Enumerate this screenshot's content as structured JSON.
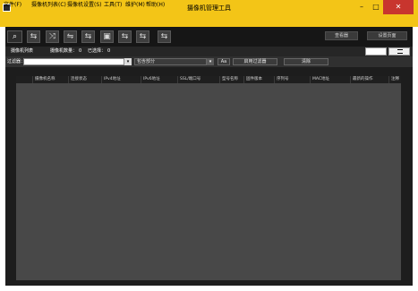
{
  "window": {
    "title": "摄像机管理工具",
    "minimize_glyph": "–",
    "maximize_glyph": "□",
    "close_glyph": "✕"
  },
  "menu": [
    {
      "label": "文件(F)"
    },
    {
      "label": "摄像机列表(C)"
    },
    {
      "label": "摄像机设置(S)"
    },
    {
      "label": "工具(T)"
    },
    {
      "label": "维护(M)"
    },
    {
      "label": "帮助(H)"
    }
  ],
  "toolbar": {
    "search_glyph": "⌕",
    "tool_glyphs": [
      "⇆",
      "⤨",
      "⇋",
      "⇆",
      "▣",
      "⇆",
      "⇆",
      "⇆"
    ],
    "right_buttons": [
      "查看器",
      "设置页面"
    ]
  },
  "subbar": {
    "list_title": "摄像机列表",
    "count_label": "摄像机数量：",
    "count_value": "0",
    "selected_label": "已选择：",
    "selected_value": "0"
  },
  "filter": {
    "label": "过滤器：",
    "input_value": "",
    "select_value": "包含部分",
    "case_button": "Aa",
    "apply_button": "启用过滤器",
    "clear_button": "清除"
  },
  "table": {
    "columns": [
      "摄像机名称",
      "连接状态",
      "IPv4地址",
      "IPv6地址",
      "SSL/端口号",
      "型号名称",
      "固件版本",
      "序列号",
      "MAC地址",
      "最新的操作",
      "注释"
    ],
    "rows": []
  }
}
